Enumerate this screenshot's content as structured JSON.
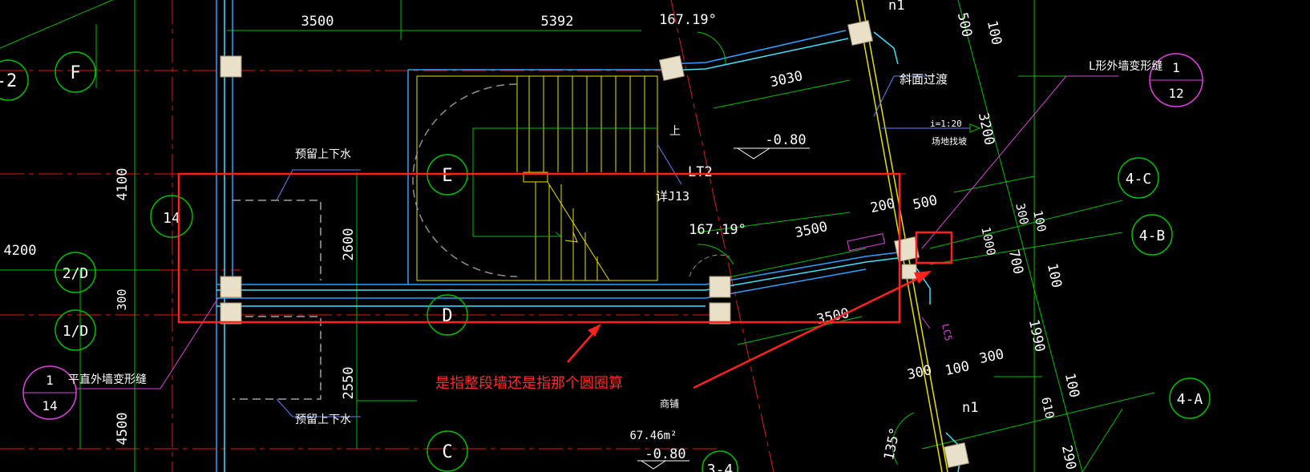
{
  "colors": {
    "background": "#000000",
    "grid_red": "#e01818",
    "grid_green": "#00c000",
    "wall_blue": "#30a0ff",
    "wall_cyan": "#40e0ff",
    "stair_yellow": "#e6e000",
    "column_fill": "#e8e0c8",
    "annotation_red": "#ff2020",
    "magenta": "#e040e0"
  },
  "dimensions": {
    "d3500_top": "3500",
    "d5392": "5392",
    "ang_top": "167.19°",
    "d3030": "3030",
    "d4100": "4100",
    "d4200": "4200",
    "d2600": "2600",
    "d2550": "2550",
    "d300_left": "300",
    "d4500": "4500",
    "ang_mid": "167.19°",
    "d3500_mid": "3500",
    "d3500_low": "3500",
    "d200": "200",
    "d500_mid": "500",
    "d500_top": "500",
    "d100_top": "100",
    "d3200": "3200",
    "d300_r": "300",
    "d100_r1": "100",
    "d1000": "1000",
    "d700": "700",
    "d100_r2": "100",
    "d1990": "1990",
    "d100_r3": "100",
    "d610": "610",
    "d290": "290",
    "d300_b": "300",
    "d100_b": "100",
    "d300_b2": "300",
    "ang_bottom": "135°"
  },
  "axes": {
    "F": "F",
    "E": "E",
    "D": "D",
    "C": "C",
    "a14": "14",
    "a2D": "2/D",
    "a1D": "1/D",
    "a4C": "4-C",
    "a4B": "4-B",
    "a4A": "4-A",
    "a2": "-2",
    "a34": "3-4"
  },
  "notes": {
    "reserved_top": "预留上下水",
    "reserved_bottom": "预留上下水",
    "flat_joint": "平直外墙变形缝",
    "l_joint": "L形外墙变形缝",
    "slope": "斜面过渡",
    "level_top": "-0.80",
    "level_bottom": "-0.80",
    "area": "67.46m²",
    "shop": "商铺",
    "ramp": "i=1:20",
    "ramp2": "场地找坡",
    "detail_ref": "详J13",
    "lt2": "LT2",
    "up": "上",
    "n1_top": "n1",
    "n1_bottom": "n1",
    "lc": "LC5"
  },
  "detail_refs": {
    "left_num": "1",
    "left_den": "14",
    "right_num": "1",
    "right_den": "12"
  },
  "annotation": {
    "question": "是指整段墙还是指那个圆圈算"
  }
}
